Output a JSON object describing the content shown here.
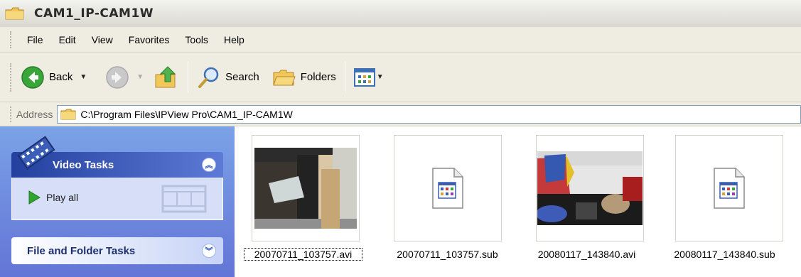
{
  "window": {
    "title": "CAM1_IP-CAM1W"
  },
  "menu": [
    "File",
    "Edit",
    "View",
    "Favorites",
    "Tools",
    "Help"
  ],
  "toolbar": {
    "back_label": "Back",
    "search_label": "Search",
    "folders_label": "Folders"
  },
  "address": {
    "label": "Address",
    "path": "C:\\Program Files\\IPView Pro\\CAM1_IP-CAM1W"
  },
  "taskpane": {
    "video_tasks_title": "Video Tasks",
    "play_all_label": "Play all",
    "file_folder_tasks_title": "File and Folder Tasks"
  },
  "files": [
    {
      "name": "20070711_103757.avi",
      "kind": "video"
    },
    {
      "name": "20070711_103757.sub",
      "kind": "document"
    },
    {
      "name": "20080117_143840.avi",
      "kind": "video"
    },
    {
      "name": "20080117_143840.sub",
      "kind": "document"
    }
  ],
  "colors": {
    "accent": "#316ac5",
    "taskpane_bg": "#7ba2e7",
    "chrome_bg": "#efede2"
  }
}
